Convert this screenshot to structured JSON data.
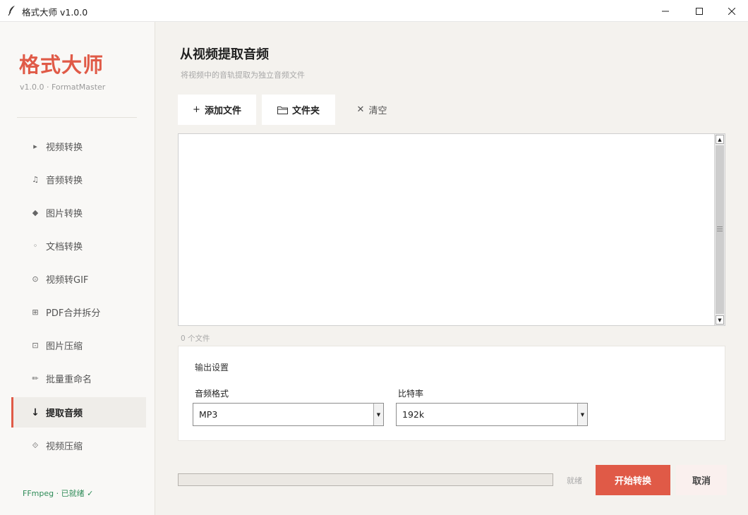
{
  "window": {
    "title": "格式大师 v1.0.0",
    "icon": "feather-icon"
  },
  "sidebar": {
    "brand": "格式大师",
    "version": "v1.0.0 · FormatMaster",
    "items": [
      {
        "icon": "▸",
        "label": "视频转换"
      },
      {
        "icon": "♫",
        "label": "音频转换"
      },
      {
        "icon": "◆",
        "label": "图片转换"
      },
      {
        "icon": "◦",
        "label": "文档转换"
      },
      {
        "icon": "⊙",
        "label": "视频转GIF"
      },
      {
        "icon": "⊞",
        "label": "PDF合并拆分"
      },
      {
        "icon": "⊡",
        "label": "图片压缩"
      },
      {
        "icon": "✏",
        "label": "批量重命名"
      },
      {
        "icon": "↓",
        "label": "提取音频",
        "active": true
      },
      {
        "icon": "⟐",
        "label": "视频压缩"
      }
    ],
    "ffmpeg_status": "FFmpeg · 已就绪 ✓"
  },
  "main": {
    "title": "从视频提取音频",
    "subtitle": "将视频中的音轨提取为独立音频文件",
    "toolbar": {
      "add_icon": "+",
      "add_label": "添加文件",
      "folder_label": "文件夹",
      "clear_icon": "✕",
      "clear_label": "清空"
    },
    "file_count": "0 个文件",
    "settings": {
      "header": "输出设置",
      "format_label": "音频格式",
      "format_value": "MP3",
      "bitrate_label": "比特率",
      "bitrate_value": "192k"
    },
    "progress": 0,
    "status": "就绪",
    "start_label": "开始转换",
    "cancel_label": "取消"
  },
  "colors": {
    "accent": "#e05a47",
    "success": "#2e8b57"
  }
}
